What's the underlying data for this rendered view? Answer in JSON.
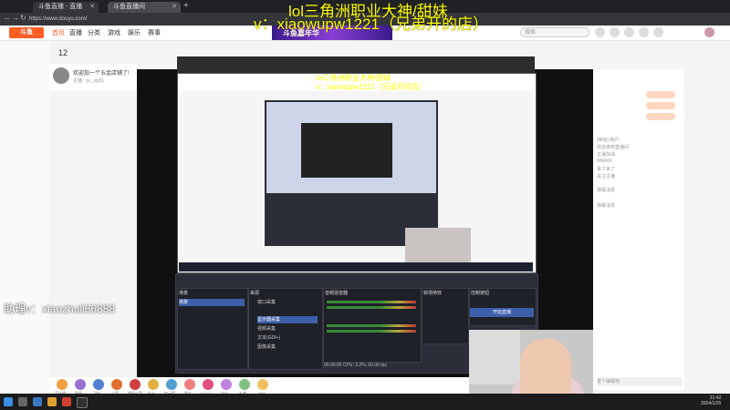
{
  "overlay": {
    "line1": "lol三角洲职业大神/甜妹",
    "line2": "v：xiaowupw1221（兄弟开的店）",
    "contact": "助理v：xiaozhuli66888"
  },
  "inner_overlay": {
    "line1": "lol三角洲职业大神/甜妹",
    "line2": "v：xiaowupw1221（兄弟开的店）"
  },
  "browser": {
    "tabs": [
      "斗鱼直播 - 直播",
      "斗鱼直播间"
    ],
    "url": "https://www.douyu.com/"
  },
  "site": {
    "logo": "斗鱼",
    "nav": [
      "首页",
      "直播",
      "分类",
      "游戏",
      "娱乐",
      "赛事"
    ],
    "promo": "斗鱼嘉年华",
    "search_placeholder": "搜索"
  },
  "room": {
    "viewers": "12",
    "title": "欢迎加一个五金店铺了!",
    "subtitle": "主播 · pc_yjy01"
  },
  "obs": {
    "scenes_label": "场景",
    "sources_label": "来源",
    "mixer_label": "音频混音器",
    "transitions_label": "转场特效",
    "controls_label": "控制按钮",
    "sources": [
      "窗口采集",
      "显示器采集",
      "视频采集",
      "文本(GDI+)",
      "图像采集"
    ],
    "start_button": "开始直播",
    "status": "00:00:00 CPU: 3.2%, 60.00 fps"
  },
  "gifts": [
    "荧光棒",
    "弱鸡",
    "飞机",
    "火箭",
    "超级火箭",
    "办卡",
    "穿云箭",
    "鱼丸",
    "小心心",
    "告白",
    "礼物",
    "666"
  ],
  "chat": {
    "lines": [
      "[等级] 用户:",
      "欢迎来到直播间",
      "主播加油",
      "666666",
      "来了来了",
      "关注主播",
      "弹幕消息",
      "弹幕消息"
    ],
    "input_placeholder": "发个弹幕吧"
  },
  "taskbar": {
    "time": "21:42",
    "date": "2024/1/25"
  }
}
